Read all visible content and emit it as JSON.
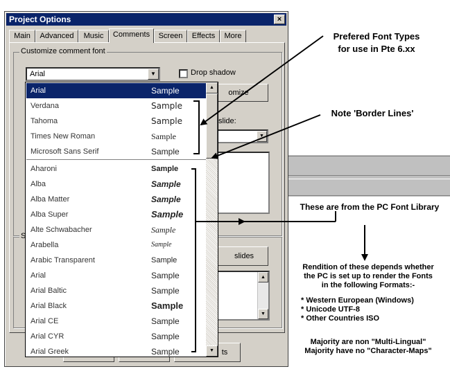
{
  "window": {
    "title": "Project Options",
    "close_label": "×"
  },
  "tabs": [
    "Main",
    "Advanced",
    "Music",
    "Comments",
    "Screen",
    "Effects",
    "More"
  ],
  "active_tab": "Comments",
  "customize_group": {
    "label": "Customize comment font",
    "selected_font": "Arial",
    "drop_shadow_label": "Drop shadow",
    "customize_button_partial": "omize",
    "slide_label_partial": "slide:"
  },
  "lower_group": {
    "label_partial": "S",
    "slides_button_partial": "slides",
    "bottom_button_partial": "ts"
  },
  "font_list": {
    "sample_text": "Sample",
    "preferred": [
      "Arial",
      "Verdana",
      "Tahoma",
      "Times New Roman",
      "Microsoft Sans Serif"
    ],
    "library": [
      "Aharoni",
      "Alba",
      "Alba Matter",
      "Alba Super",
      "Alte Schwabacher",
      "Arabella",
      "Arabic Transparent",
      "Arial",
      "Arial Baltic",
      "Arial Black",
      "Arial CE",
      "Arial CYR",
      "Arial Greek"
    ]
  },
  "annotations": {
    "preferred_line1": "Prefered Font Types",
    "preferred_line2": "for use in Pte 6.xx",
    "border_lines": "Note 'Border Lines'",
    "pc_library": "These are from the PC Font Library",
    "rendition_line1": "Rendition of these depends whether",
    "rendition_line2": "the PC is set up to render the Fonts",
    "rendition_line3": "in the following Formats:-",
    "formats": [
      "*  Western European (Windows)",
      "*  Unicode UTF-8",
      "*  Other Countries ISO"
    ],
    "majority_line1": "Majority are non \"Multi-Lingual\"",
    "majority_line2": "Majority have no \"Character-Maps\""
  }
}
